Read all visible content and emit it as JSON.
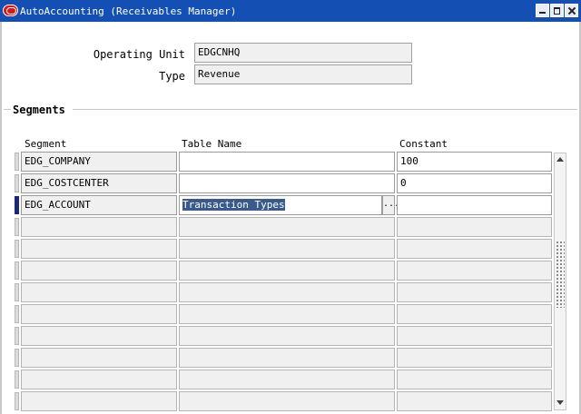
{
  "window": {
    "title": "AutoAccounting (Receivables Manager)"
  },
  "header_fields": {
    "operating_unit_label": "Operating Unit",
    "operating_unit_value": "EDGCNHQ",
    "type_label": "Type",
    "type_value": "Revenue"
  },
  "segments": {
    "section_title": "Segments",
    "columns": {
      "segment": "Segment",
      "table_name": "Table Name",
      "constant": "Constant"
    },
    "rows": [
      {
        "segment": "EDG_COMPANY",
        "table_name": "",
        "constant": "100"
      },
      {
        "segment": "EDG_COSTCENTER",
        "table_name": "",
        "constant": "0"
      },
      {
        "segment": "EDG_ACCOUNT",
        "table_name": "Transaction Types",
        "constant": ""
      },
      {
        "segment": "",
        "table_name": "",
        "constant": ""
      },
      {
        "segment": "",
        "table_name": "",
        "constant": ""
      },
      {
        "segment": "",
        "table_name": "",
        "constant": ""
      },
      {
        "segment": "",
        "table_name": "",
        "constant": ""
      },
      {
        "segment": "",
        "table_name": "",
        "constant": ""
      },
      {
        "segment": "",
        "table_name": "",
        "constant": ""
      },
      {
        "segment": "",
        "table_name": "",
        "constant": ""
      },
      {
        "segment": "",
        "table_name": "",
        "constant": ""
      },
      {
        "segment": "",
        "table_name": "",
        "constant": ""
      }
    ],
    "current_row": 3,
    "lov_button_label": "..."
  },
  "icons": {
    "app": "oracle-icon",
    "minimize": "minimize-icon",
    "maximize": "maximize-icon",
    "close": "close-icon",
    "scroll_up": "scroll-up-icon",
    "scroll_down": "scroll-down-icon"
  },
  "colors": {
    "titlebar": "#1450b4",
    "selection": "#3a5a8c",
    "current_record_marker": "#1a2a78"
  }
}
